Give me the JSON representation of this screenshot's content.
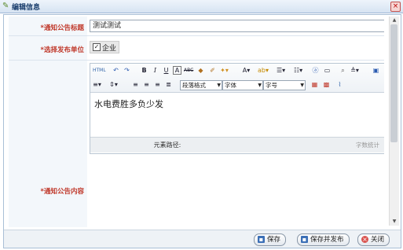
{
  "window": {
    "title": "编辑信息",
    "close_icon": "close-icon",
    "edit_icon": "pencil-icon"
  },
  "form": {
    "title_label": "*通知公告标题",
    "title_value": "测试测试",
    "unit_label": "*选择发布单位",
    "unit_option": "企业",
    "content_label": "*通知公告内容"
  },
  "editor": {
    "toolbar_selects": [
      "段落格式",
      "字体",
      "字号"
    ],
    "body_text": "水电费胜多负少发",
    "status_path_label": "元素路径:",
    "word_count_label": "字数统计"
  },
  "footer": {
    "save_label": "保存",
    "save_publish_label": "保存并发布",
    "close_label": "关闭"
  }
}
